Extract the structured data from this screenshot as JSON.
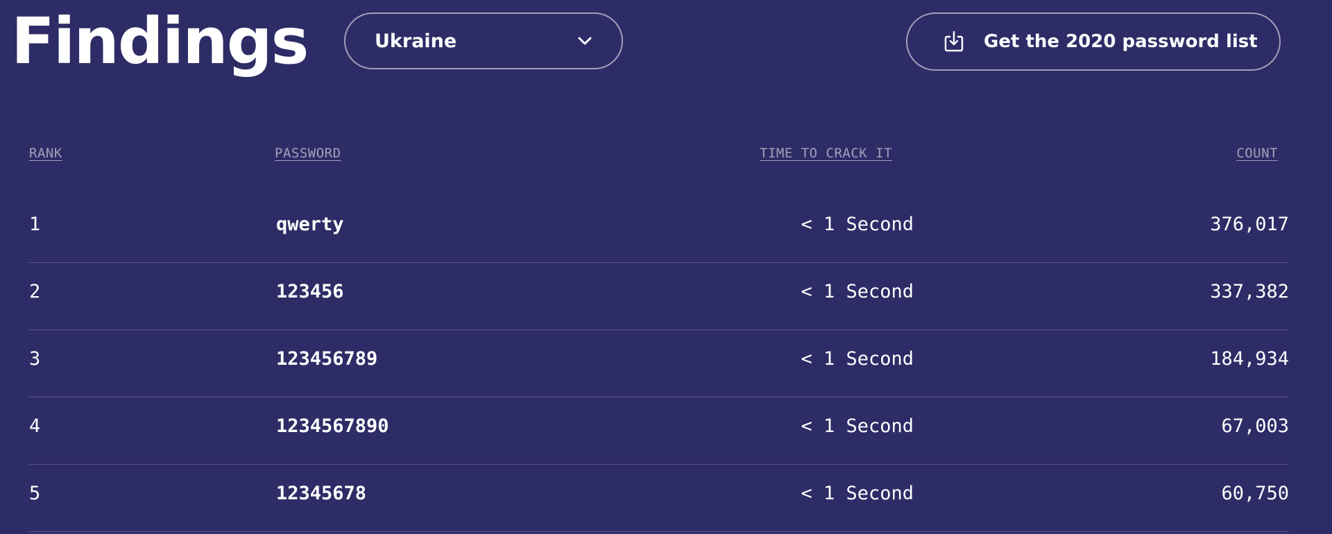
{
  "page": {
    "title": "Findings"
  },
  "country_select": {
    "selected": "Ukraine",
    "icon": "chevron-down-icon"
  },
  "download": {
    "label": "Get the 2020 password list",
    "icon": "download-icon"
  },
  "table": {
    "columns": {
      "rank": "RANK",
      "password": "PASSWORD",
      "time": "TIME TO CRACK IT",
      "count": "COUNT"
    },
    "rows": [
      {
        "rank": "1",
        "password": "qwerty",
        "time": "< 1 Second",
        "count": "376,017"
      },
      {
        "rank": "2",
        "password": "123456",
        "time": "< 1 Second",
        "count": "337,382"
      },
      {
        "rank": "3",
        "password": "123456789",
        "time": "< 1 Second",
        "count": "184,934"
      },
      {
        "rank": "4",
        "password": "1234567890",
        "time": "< 1 Second",
        "count": "67,003"
      },
      {
        "rank": "5",
        "password": "12345678",
        "time": "< 1 Second",
        "count": "60,750"
      }
    ]
  },
  "colors": {
    "background": "#2e2c66",
    "text": "#ffffff",
    "muted": "#8e8cb8"
  }
}
